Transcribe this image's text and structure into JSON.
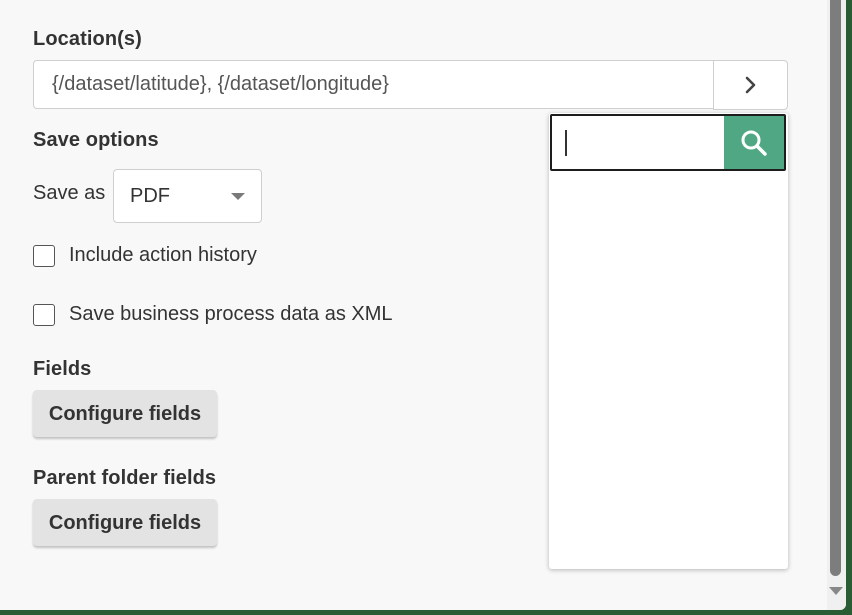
{
  "location": {
    "label": "Location(s)",
    "value": "{/dataset/latitude}, {/dataset/longitude}",
    "expand_icon": "chevron-right-icon"
  },
  "save_options": {
    "heading": "Save options",
    "save_as_label": "Save as",
    "save_as_value": "PDF",
    "include_action_history": {
      "label": "Include action history",
      "checked": false
    },
    "save_bp_xml": {
      "label": "Save business process data as XML",
      "checked": false
    }
  },
  "fields": {
    "heading": "Fields",
    "button_label": "Configure fields"
  },
  "parent_folder_fields": {
    "heading": "Parent folder fields",
    "button_label": "Configure fields"
  },
  "dropdown": {
    "search_value": "",
    "search_icon": "search-icon",
    "accent": "#4fa883"
  }
}
